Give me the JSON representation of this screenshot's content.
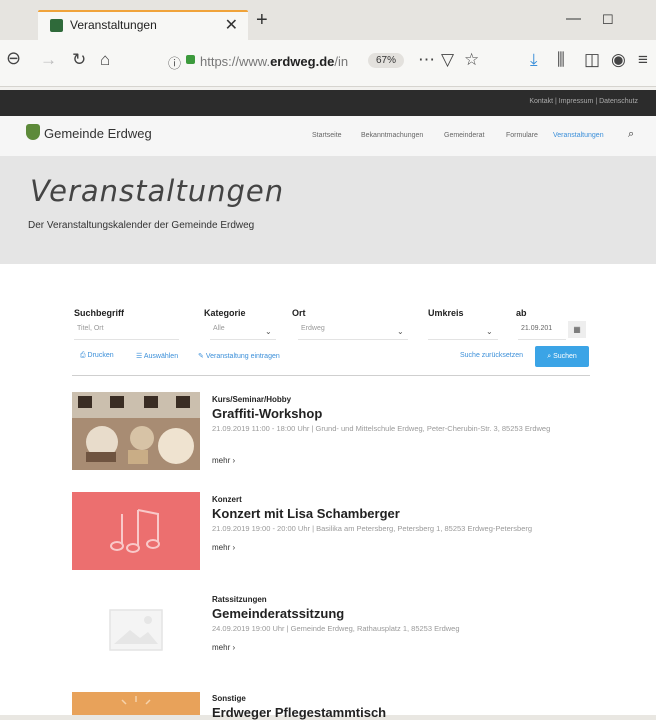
{
  "browser": {
    "tab_title": "Veranstaltungen",
    "url_prefix": "https://www.",
    "url_domain": "erdweg.de",
    "url_suffix": "/in",
    "zoom": "67%"
  },
  "site": {
    "top_links": "Kontakt | Impressum | Datenschutz",
    "name": "Gemeinde Erdweg",
    "menu": [
      "Startseite",
      "Bekanntmachungen",
      "Gemeinderat",
      "Formulare",
      "Veranstaltungen"
    ],
    "page_title": "Veranstaltungen",
    "page_subtitle": "Der Veranstaltungskalender der Gemeinde Erdweg"
  },
  "filters": {
    "search_label": "Suchbegriff",
    "search_placeholder": "Titel, Ort",
    "category_label": "Kategorie",
    "category_value": "Alle",
    "place_label": "Ort",
    "place_value": "Erdweg",
    "radius_label": "Umkreis",
    "date_label": "ab",
    "date_value": "21.09.201"
  },
  "toolbar": {
    "print": "Drucken",
    "list": "Auswählen",
    "submit": "Veranstaltung eintragen",
    "reset": "Suche zurücksetzen",
    "search": "Suchen"
  },
  "events": [
    {
      "category": "Kurs/Seminar/Hobby",
      "title": "Graffiti-Workshop",
      "meta": "21.09.2019 11:00 - 18:00 Uhr | Grund- und Mittelschule Erdweg, Peter-Cherubin-Str. 3, 85253 Erdweg",
      "more": "mehr ›"
    },
    {
      "category": "Konzert",
      "title": "Konzert mit Lisa Schamberger",
      "meta": "21.09.2019 19:00 - 20:00 Uhr | Basilika am Petersberg, Petersberg 1, 85253 Erdweg-Petersberg",
      "more": "mehr ›"
    },
    {
      "category": "Ratssitzungen",
      "title": "Gemeinderatssitzung",
      "meta": "24.09.2019 19:00 Uhr | Gemeinde Erdweg, Rathausplatz 1, 85253 Erdweg",
      "more": "mehr ›"
    },
    {
      "category": "Sonstige",
      "title": "Erdweger Pflegestammtisch",
      "meta": "",
      "more": ""
    }
  ],
  "colors": {
    "accent_blue": "#3ba4e6",
    "concert_tile": "#ec6f6f",
    "sonstige_tile": "#e8a25a",
    "logo_green": "#5d8a3a"
  }
}
